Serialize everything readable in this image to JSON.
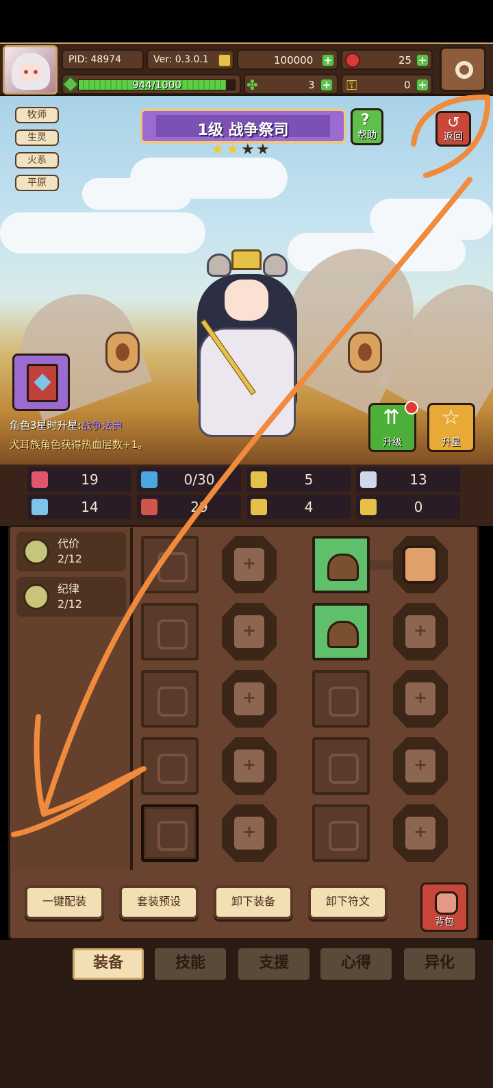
{
  "header": {
    "pid": "PID: 48974",
    "version": "Ver: 0.3.0.1",
    "coins": "100000",
    "gems": "25",
    "xp_text": "944/1000",
    "xp_fraction": 0.944,
    "clover": "3",
    "keys": "0"
  },
  "tags": [
    "牧师",
    "生灵",
    "火系",
    "平原"
  ],
  "character": {
    "level_title": "1级  战争祭司",
    "stars_filled": 2,
    "stars_total": 4,
    "help_label": "帮助",
    "back_label": "返回"
  },
  "perk": {
    "line1_prefix": "角色3星时升星:",
    "line1_link": "战争法典",
    "line2": "犬耳族角色获得热血层数+1。"
  },
  "side_buttons": {
    "upgrade": "升级",
    "star_up": "升星"
  },
  "stats": [
    {
      "icon": "heart-icon",
      "value": "19",
      "color": "#e0566a"
    },
    {
      "icon": "mana-drop-icon",
      "value": "0/30",
      "color": "#4aa7e0"
    },
    {
      "icon": "shield-stat-icon",
      "value": "5",
      "color": "#e6c14a"
    },
    {
      "icon": "wing-icon",
      "value": "13",
      "color": "#cfd8e6"
    },
    {
      "icon": "fist-icon",
      "value": "14",
      "color": "#7fc3e8"
    },
    {
      "icon": "book-stat-icon",
      "value": "29",
      "color": "#d0554a"
    },
    {
      "icon": "boot-stat-icon",
      "value": "4",
      "color": "#e6c14a"
    },
    {
      "icon": "horseshoe-icon",
      "value": "0",
      "color": "#e6c14a"
    }
  ],
  "set_bonuses": [
    {
      "name": "代价",
      "count": "2/12"
    },
    {
      "name": "纪律",
      "count": "2/12"
    }
  ],
  "actions": {
    "auto_equip": "一键配装",
    "preset": "套装预设",
    "unequip": "卸下装备",
    "unequip_runes": "卸下符文",
    "bag": "背包"
  },
  "tabs": [
    {
      "label": "装备",
      "active": true
    },
    {
      "label": "技能",
      "active": false
    },
    {
      "label": "支援",
      "active": false
    },
    {
      "label": "心得",
      "active": false
    },
    {
      "label": "异化",
      "active": false
    }
  ]
}
